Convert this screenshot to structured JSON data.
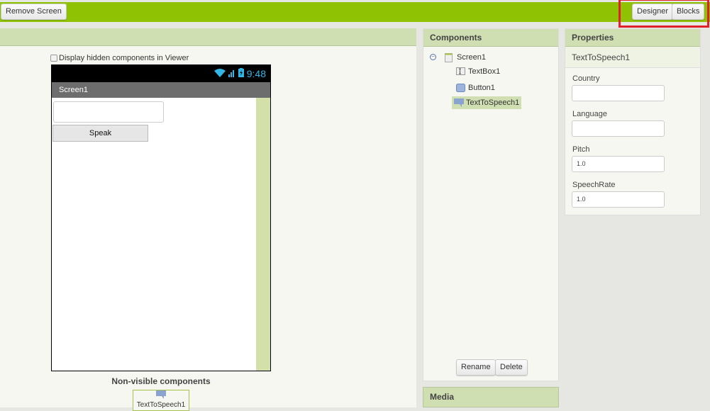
{
  "toolbar": {
    "remove_screen": "Remove Screen",
    "designer": "Designer",
    "blocks": "Blocks"
  },
  "viewer": {
    "display_hidden_label": "Display hidden components in Viewer",
    "display_hidden_checked": false,
    "status_time": "9:48",
    "screen_title": "Screen1",
    "textbox_value": "",
    "speak_button": "Speak",
    "nonvisible_title": "Non-visible components",
    "nonvisible_items": [
      "TextToSpeech1"
    ]
  },
  "components": {
    "title": "Components",
    "tree": [
      {
        "label": "Screen1",
        "icon": "screen-icon"
      },
      {
        "label": "TextBox1",
        "icon": "textbox-icon"
      },
      {
        "label": "Button1",
        "icon": "button-icon"
      },
      {
        "label": "TextToSpeech1",
        "icon": "speech-bubble-icon",
        "selected": true
      }
    ],
    "rename": "Rename",
    "delete": "Delete"
  },
  "media": {
    "title": "Media"
  },
  "properties": {
    "title": "Properties",
    "component": "TextToSpeech1",
    "fields": [
      {
        "label": "Country",
        "value": ""
      },
      {
        "label": "Language",
        "value": ""
      },
      {
        "label": "Pitch",
        "value": "1.0"
      },
      {
        "label": "SpeechRate",
        "value": "1.0"
      }
    ]
  },
  "colors": {
    "topbar": "#8fc202",
    "panel_header": "#cfdfb2",
    "highlight_border": "#e0202a",
    "status_accent": "#33b5e5"
  }
}
